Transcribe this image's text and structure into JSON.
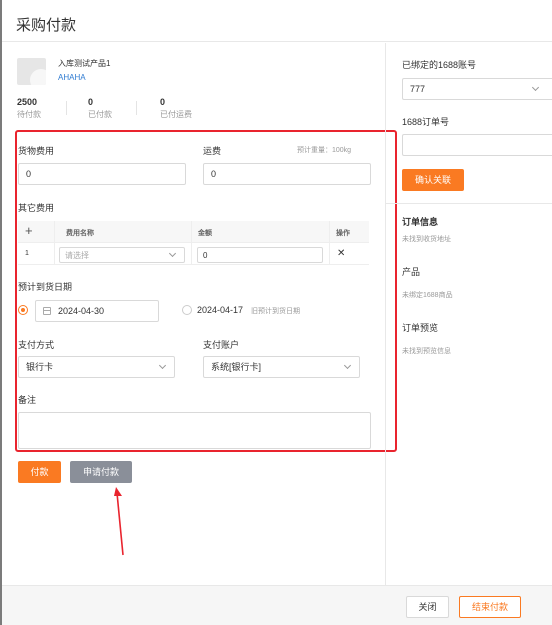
{
  "dialog": {
    "title": "采购付款"
  },
  "product": {
    "name": "入库测试产品1",
    "code": "AHAHA",
    "stats": [
      {
        "value": "2500",
        "label": "待付款"
      },
      {
        "value": "0",
        "label": "已付款"
      },
      {
        "value": "0",
        "label": "已付运费"
      }
    ]
  },
  "form": {
    "goods_fee": {
      "label": "货物费用",
      "value": "0"
    },
    "shipping": {
      "label": "运费",
      "hint": "预计重量：100kg",
      "value": "0"
    },
    "other_fees": {
      "label": "其它费用",
      "columns": {
        "add": "+",
        "name": "费用名称",
        "amount": "金额",
        "action": "操作"
      },
      "rows": [
        {
          "index": "1",
          "name_placeholder": "请选择",
          "amount": "0",
          "delete": "✕"
        }
      ]
    },
    "arrival": {
      "label": "预计到货日期",
      "option1_date": "2024-04-30",
      "option2_date": "2024-04-17",
      "option2_hint": "旧预计到货日期"
    },
    "payment_method": {
      "label": "支付方式",
      "value": "银行卡"
    },
    "payment_account": {
      "label": "支付账户",
      "value": "系统[银行卡]"
    },
    "remark": {
      "label": "备注",
      "value": ""
    }
  },
  "actions": {
    "pay": "付款",
    "request_pay": "申请付款"
  },
  "right": {
    "account_label": "已绑定的1688账号",
    "account_value": "777",
    "order_label": "1688订单号",
    "order_value": "",
    "confirm": "确认关联",
    "order_info_title": "订单信息",
    "order_info_sub": "未找到收货地址",
    "product_title": "产品",
    "product_sub": "未绑定1688商品",
    "preview_title": "订单预览",
    "preview_sub": "未找到预览信息"
  },
  "footer": {
    "close": "关闭",
    "finish": "结束付款"
  },
  "colors": {
    "accent": "#fa7a22",
    "highlight": "#e9242e",
    "link": "#2f7bd1"
  }
}
